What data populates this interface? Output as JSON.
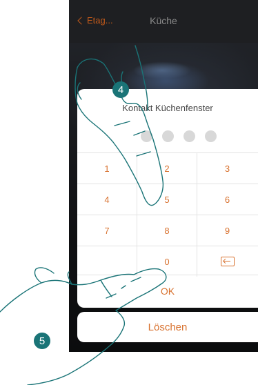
{
  "nav": {
    "back_label": "Etag...",
    "title": "Küche"
  },
  "dialog": {
    "title": "Kontakt Küchenfenster",
    "pin_dots": 4,
    "keys": [
      [
        "1",
        "2",
        "3"
      ],
      [
        "4",
        "5",
        "6"
      ],
      [
        "7",
        "8",
        "9"
      ],
      [
        "",
        "0",
        "backspace-icon"
      ]
    ],
    "ok_label": "OK"
  },
  "delete_label": "Löschen",
  "steps": {
    "step_a": "4",
    "step_b": "5"
  },
  "colors": {
    "accent": "#d8712e",
    "badge": "#1a7477",
    "navbar": "#1e1f22"
  }
}
